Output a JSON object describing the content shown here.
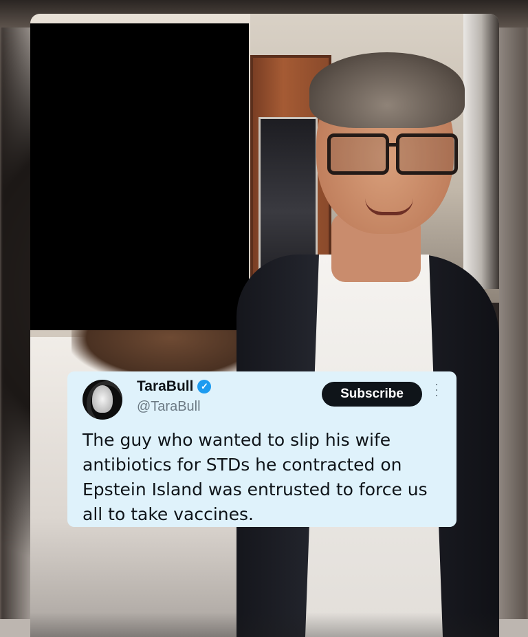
{
  "tweet": {
    "display_name": "TaraBull",
    "handle": "@TaraBull",
    "verified_icon": "verified-checkmark-icon",
    "subscribe_label": "Subscribe",
    "more_icon": "more-options-icon",
    "text": "The guy who wanted to slip his wife antibiotics for STDs he contracted on Epstein Island was entrusted to force us all to take vaccines."
  },
  "colors": {
    "tweet_background": "#dff2fb",
    "verified_badge": "#1d9bf0",
    "subscribe_button": "#0f1419",
    "handle_text": "#6c7a84"
  }
}
